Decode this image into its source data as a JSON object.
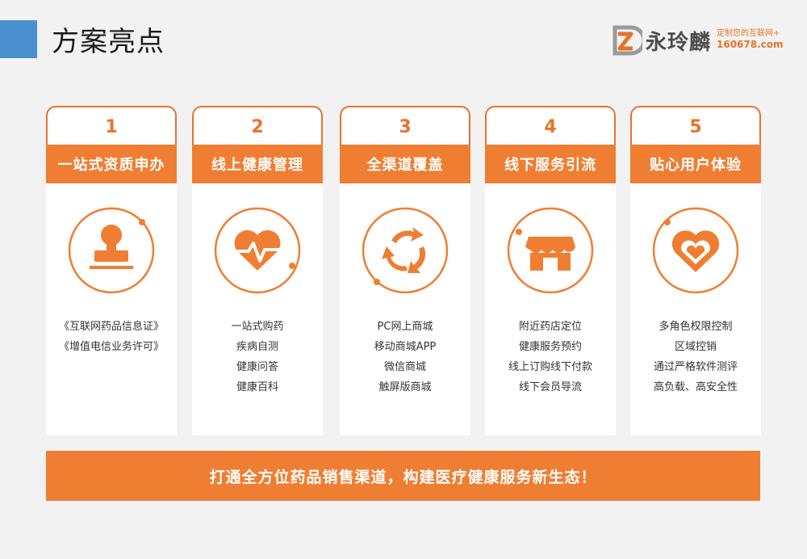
{
  "page": {
    "title": "方案亮点"
  },
  "brand": {
    "name": "永玲麟",
    "tagline": "定制您的互联网+",
    "url": "160678.com",
    "accent_color": "#ef7e32",
    "secondary_color": "#4a8fd0"
  },
  "cards": [
    {
      "number": "1",
      "title": "一站式资质申办",
      "icon": "stamp-icon",
      "items": [
        "《互联网药品信息证》",
        "《增值电信业务许可》"
      ]
    },
    {
      "number": "2",
      "title": "线上健康管理",
      "icon": "heartbeat-icon",
      "items": [
        "一站式购药",
        "疾病自测",
        "健康问答",
        "健康百科"
      ]
    },
    {
      "number": "3",
      "title": "全渠道覆盖",
      "icon": "refresh-arrows-icon",
      "items": [
        "PC网上商城",
        "移动商城APP",
        "微信商城",
        "触屏版商城"
      ]
    },
    {
      "number": "4",
      "title": "线下服务引流",
      "icon": "storefront-icon",
      "items": [
        "附近药店定位",
        "健康服务预约",
        "线上订购线下付款",
        "线下会员导流"
      ]
    },
    {
      "number": "5",
      "title": "贴心用户体验",
      "icon": "heart-icon",
      "items": [
        "多角色权限控制",
        "区域控销",
        "通过严格软件测评",
        "高负载、高安全性"
      ]
    }
  ],
  "banner": {
    "text": "打通全方位药品销售渠道，构建医疗健康服务新生态！"
  }
}
